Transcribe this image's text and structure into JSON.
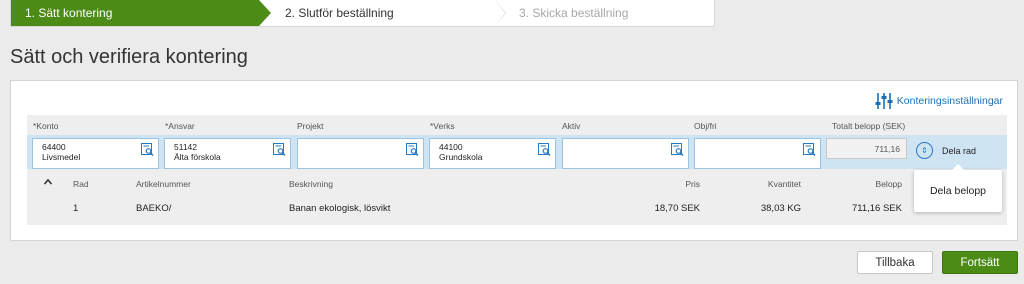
{
  "wizard": {
    "steps": [
      {
        "label": "1. Sätt kontering",
        "state": "active"
      },
      {
        "label": "2. Slutför beställning",
        "state": "next"
      },
      {
        "label": "3. Skicka beställning",
        "state": "disabled"
      }
    ]
  },
  "page": {
    "title": "Sätt och verifiera kontering"
  },
  "settings": {
    "label": "Konteringsinställningar"
  },
  "coding": {
    "labels": {
      "konto": "*Konto",
      "ansvar": "*Ansvar",
      "projekt": "Projekt",
      "verks": "*Verks",
      "aktiv": "Aktiv",
      "objfri": "Obj/fri",
      "total": "Totalt belopp (SEK)"
    },
    "fields": {
      "konto": {
        "code": "64400",
        "name": "Livsmedel"
      },
      "ansvar": {
        "code": "51142",
        "name": "Älta förskola"
      },
      "projekt": {
        "code": "",
        "name": ""
      },
      "verks": {
        "code": "44100",
        "name": "Grundskola"
      },
      "aktiv": {
        "code": "",
        "name": ""
      },
      "objfri": {
        "code": "",
        "name": ""
      }
    },
    "total": "711,16",
    "split_label": "Dela rad"
  },
  "table": {
    "headers": {
      "rad": "Rad",
      "artikel": "Artikelnummer",
      "beskrivning": "Beskrivning",
      "pris": "Pris",
      "kvantitet": "Kvantitet",
      "belopp": "Belopp"
    },
    "rows": [
      {
        "rad": "1",
        "artikel": "BAEKO/",
        "beskrivning": "Banan ekologisk, lösvikt",
        "pris": "18,70 SEK",
        "kvantitet": "38,03 KG",
        "belopp": "711,16 SEK"
      }
    ]
  },
  "tooltip": {
    "text": "Dela belopp"
  },
  "buttons": {
    "back": "Tillbaka",
    "next": "Fortsätt"
  },
  "colors": {
    "accent_green": "#4c8b16",
    "link_blue": "#1a6fb5",
    "field_row_bg": "#cfe4f3"
  },
  "icons": {
    "lookup": "search-document-icon",
    "settings": "sliders-icon",
    "split": "expand-circle-icon",
    "collapse": "chevron-up-icon"
  }
}
